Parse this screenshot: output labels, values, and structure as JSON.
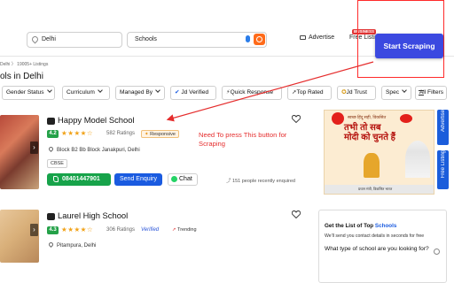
{
  "header": {
    "location_value": "Delhi",
    "search_value": "Schools",
    "advertise_label": "Advertise",
    "free_listing_label": "Free Listi",
    "business_badge": "BUSINESS",
    "start_scraping_label": "Start Scraping"
  },
  "breadcrumb": "Delhi  〉 19005+ Listings",
  "page_title": "ols in Delhi",
  "filters": {
    "gender_status": "Gender Status",
    "curriculum": "Curriculum",
    "managed_by": "Managed By",
    "jd_verified": "Jd Verified",
    "quick_response": "Quick Response",
    "top_rated": "Top Rated",
    "jd_trust": "Jd Trust",
    "spec": "Spec",
    "all_filters": "All Filters"
  },
  "annotation": "Need To press This button for Scraping",
  "listings": [
    {
      "name": "Happy Model School",
      "rating": "4.2",
      "stars": "★★★★☆",
      "ratings_count": "582 Ratings",
      "tag": "Responsive",
      "address": "Block B2 Bb Block Janakpuri, Delhi",
      "board": "CBSE",
      "phone": "08401447901",
      "enquiry_label": "Send Enquiry",
      "chat_label": "Chat",
      "recent_text": "151 people recently enquired"
    },
    {
      "name": "Laurel High School",
      "rating": "4.3",
      "stars": "★★★★☆",
      "ratings_count": "306 Ratings",
      "verified_label": "Verified",
      "tag": "Trending",
      "address": "Pitampura, Delhi"
    }
  ],
  "ad": {
    "top_text": "स्वच्छ हिंदू सही, विकसित",
    "main_line1": "तभी तो सब",
    "main_line2": "मोदी को चुनते हैं",
    "bottom_text": "प्रधान मंत्री, विकसित भारत"
  },
  "side_tabs": {
    "advertise": "Advertise",
    "free_listing": "Free Listing"
  },
  "get_list": {
    "title_prefix": "Get the List of Top",
    "title_highlight": "Schools",
    "subtitle": "We'll send you contact details in seconds for free",
    "question": "What type of school are you looking for?"
  },
  "colors": {
    "brand_blue": "#1a5be0",
    "scrape_button": "#3b49e0",
    "annotation_red": "#e52d2d",
    "rating_green": "#24a148",
    "search_orange": "#ff6b1a"
  }
}
